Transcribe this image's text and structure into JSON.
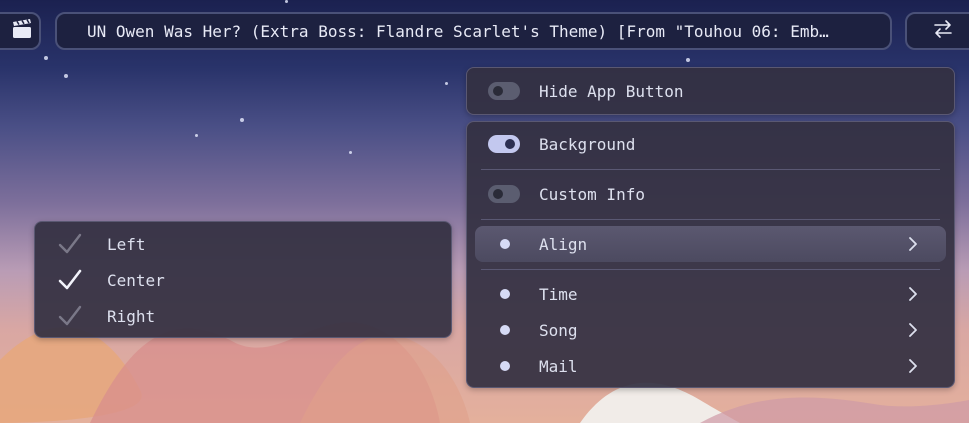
{
  "topbar": {
    "left_icon": "clapperboard-icon",
    "title": "UN Owen Was Her? (Extra Boss: Flandre Scarlet's Theme) [From \"Touhou 06: Emb…",
    "right_icon": "swap-arrows-icon"
  },
  "settings_menu": {
    "hide_app_button": {
      "label": "Hide App Button",
      "enabled": false
    },
    "background": {
      "label": "Background",
      "enabled": true
    },
    "custom_info": {
      "label": "Custom Info",
      "enabled": false
    },
    "align": {
      "label": "Align",
      "highlighted": true
    },
    "time": {
      "label": "Time"
    },
    "song": {
      "label": "Song"
    },
    "mail": {
      "label": "Mail"
    }
  },
  "align_submenu": {
    "options": [
      {
        "label": "Left",
        "checked": false
      },
      {
        "label": "Center",
        "checked": true
      },
      {
        "label": "Right",
        "checked": false
      }
    ]
  },
  "colors": {
    "accent": "#c3c8ef",
    "panel_bg": "#343042",
    "topbar_bg": "#1d2140"
  }
}
